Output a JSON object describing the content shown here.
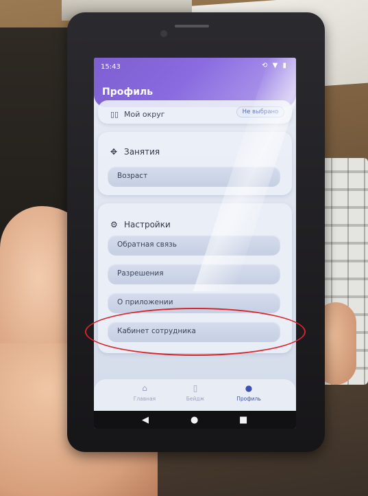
{
  "status_bar": {
    "time": "15:43"
  },
  "header": {
    "title": "Профиль"
  },
  "district": {
    "label": "Мой округ",
    "value": "Не выбрано"
  },
  "activities": {
    "title": "Занятия",
    "age_label": "Возраст"
  },
  "settings": {
    "title": "Настройки",
    "items": [
      {
        "label": "Обратная связь"
      },
      {
        "label": "Разрешения"
      },
      {
        "label": "О приложении"
      },
      {
        "label": "Кабинет сотрудника"
      }
    ]
  },
  "bottom_nav": {
    "items": [
      {
        "label": "Главная",
        "icon": "home-icon"
      },
      {
        "label": "Бейдж",
        "icon": "badge-icon"
      },
      {
        "label": "Профиль",
        "icon": "person-icon",
        "active": true
      }
    ]
  },
  "colors": {
    "header_start": "#7e5fd0",
    "accent": "#3d4fb0",
    "highlight": "#d8262c"
  }
}
